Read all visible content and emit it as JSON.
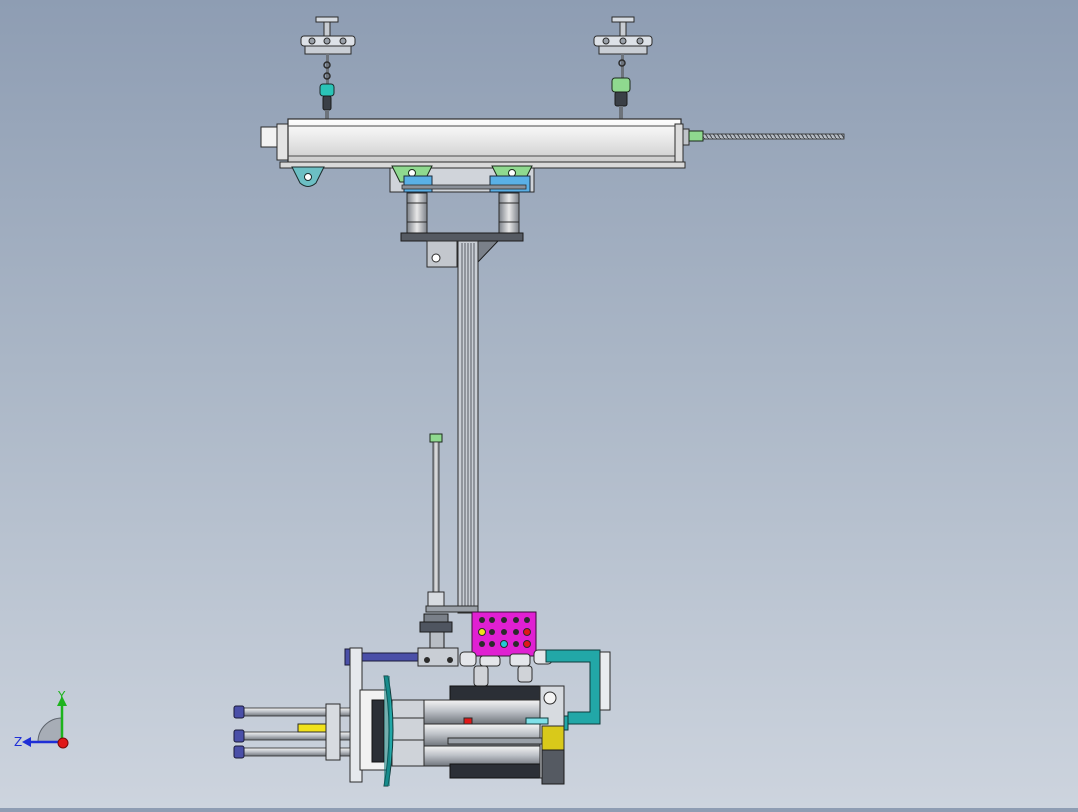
{
  "viewport": {
    "background_top": "#8e9db3",
    "background_bottom": "#cdd4de"
  },
  "triad": {
    "y_label": "Y",
    "z_label": "Z",
    "y_color": "#1db31d",
    "z_color": "#1f2fd6",
    "x_color": "#e01818"
  },
  "colors": {
    "beam_body": "#ececec",
    "outline": "#2b2b2b",
    "steel": "#b9bec6",
    "bracket_green": "#8fd98f",
    "bracket_teal": "#6cbfc4",
    "bracket_blue": "#5ab0e6",
    "control_panel": "#e020d2",
    "arm_blue": "#4a4fa8",
    "cyan_handle": "#22a7a7",
    "accent_yellow": "#f1e21a",
    "dark_plate": "#555a62"
  },
  "assembly": {
    "components": [
      "trolley-left",
      "trolley-right",
      "lead-screw-beam",
      "mast-column",
      "gas-spring",
      "control-panel",
      "drill-head",
      "handle-frame"
    ]
  }
}
